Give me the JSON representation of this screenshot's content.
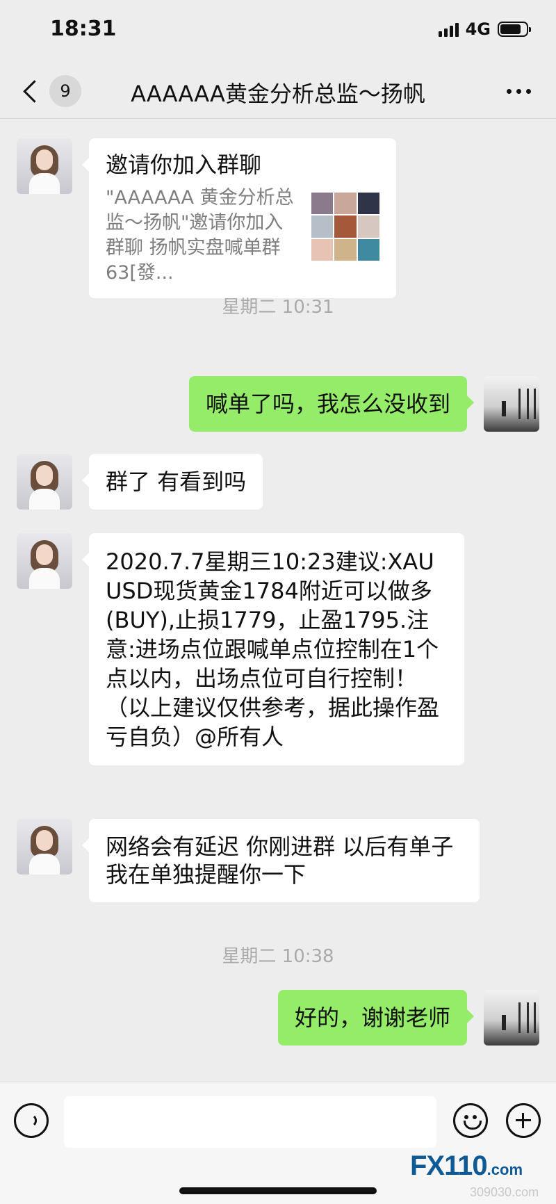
{
  "status_bar": {
    "time": "18:31",
    "network": "4G",
    "battery_level": 0.8
  },
  "nav": {
    "back_count": "9",
    "title": "AAAAAA黄金分析总监～扬帆"
  },
  "messages": {
    "invite": {
      "title": "邀请你加入群聊",
      "desc": "\"AAAAAA 黄金分析总监～扬帆\"邀请你加入群聊 扬帆实盘喊单群 63[發..."
    },
    "time1": "星期二 10:31",
    "m1": "喊单了吗，我怎么没收到",
    "m2": "群了 有看到吗",
    "m3": "2020.7.7星期三10:23建议:XAUUSD现货黄金1784附近可以做多(BUY),止损1779，止盈1795.注意:进场点位跟喊单点位控制在1个点以内，出场点位可自行控制！（以上建议仅供参考，据此操作盈亏自负）@所有人",
    "m4": "网络会有延迟  你刚进群   以后有单子我在单独提醒你一下",
    "time2": "星期二 10:38",
    "m5": "好的，谢谢老师"
  },
  "input_bar": {
    "text_value": ""
  },
  "watermark": {
    "brand": "FX110",
    "suffix": ".com",
    "sub": "309030.com"
  },
  "colors": {
    "background": "#ededed",
    "sent_bubble": "#95ec69",
    "received_bubble": "#ffffff"
  }
}
